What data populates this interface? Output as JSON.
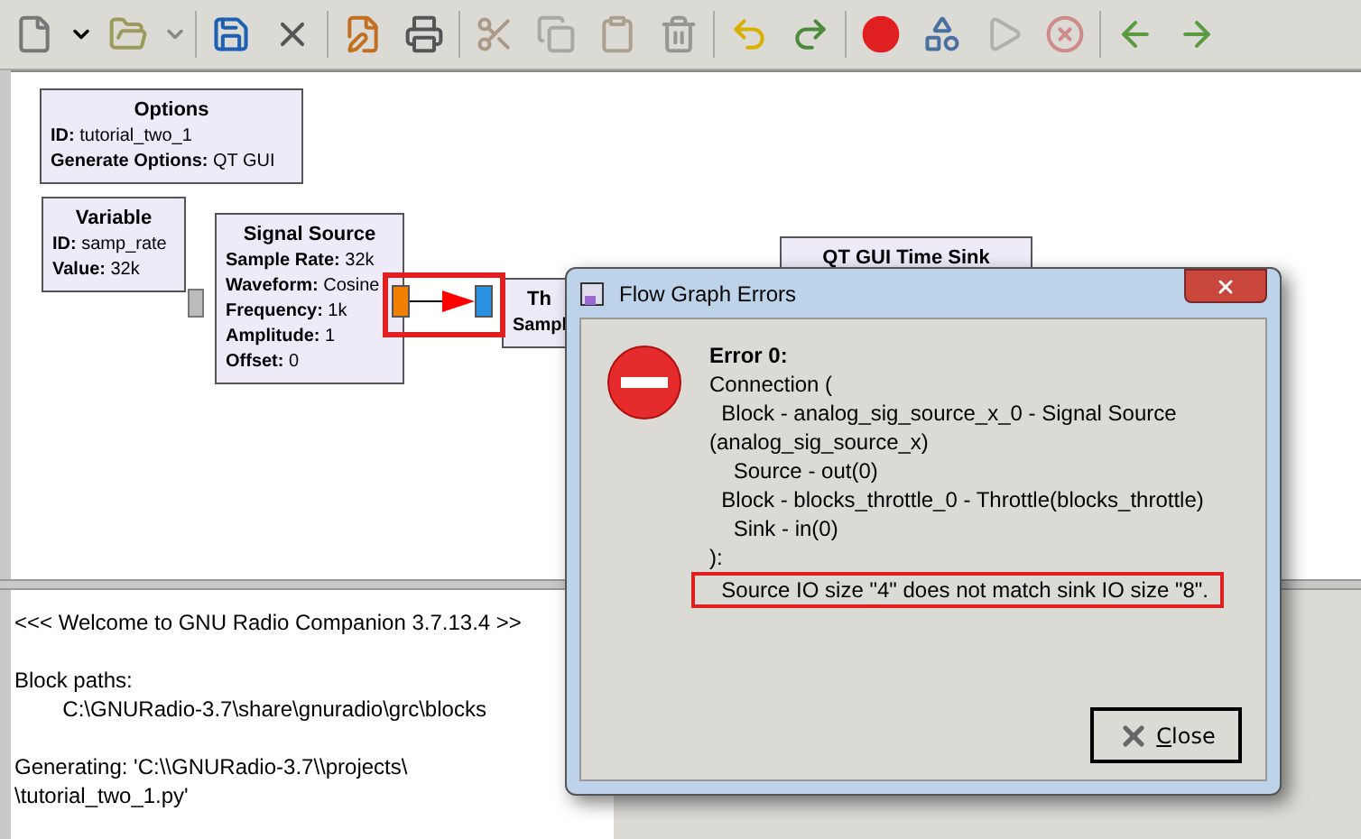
{
  "toolbar": [
    {
      "disabled": false
    },
    {
      "disabled": false
    },
    {
      "disabled": false
    },
    {
      "disabled": false
    },
    {
      "disabled": false
    },
    {
      "disabled": false
    },
    {
      "disabled": false
    },
    {
      "disabled": false
    },
    {
      "disabled": true
    },
    {
      "disabled": true
    },
    {
      "disabled": true
    },
    {
      "disabled": true
    },
    {
      "disabled": false
    },
    {
      "disabled": false
    },
    {
      "disabled": false
    },
    {
      "disabled": false
    },
    {
      "disabled": true
    },
    {
      "disabled": true
    },
    {
      "disabled": false
    },
    {
      "disabled": false
    }
  ],
  "canvas": {
    "blocks": [
      {
        "title": "Options",
        "params": [
          {
            "key": "ID:",
            "value": "tutorial_two_1"
          },
          {
            "key": "Generate Options:",
            "value": "QT GUI"
          }
        ]
      },
      {
        "title": "Variable",
        "params": [
          {
            "key": "ID:",
            "value": "samp_rate"
          },
          {
            "key": "Value:",
            "value": "32k"
          }
        ]
      },
      {
        "title": "Signal Source",
        "params": [
          {
            "key": "Sample Rate:",
            "value": "32k"
          },
          {
            "key": "Waveform:",
            "value": "Cosine"
          },
          {
            "key": "Frequency:",
            "value": "1k"
          },
          {
            "key": "Amplitude:",
            "value": "1"
          },
          {
            "key": "Offset:",
            "value": "0"
          }
        ]
      },
      {
        "title": "Th",
        "params": [
          {
            "key": "Sampl"
          }
        ]
      },
      {
        "title": "QT GUI Time Sink"
      }
    ]
  },
  "console": {
    "paragraphs": [
      [
        "<<< Welcome to GNU Radio Companion 3.7.13.4 >>"
      ],
      [
        "Block paths:",
        "        C:\\GNURadio-3.7\\share\\gnuradio\\grc\\blocks"
      ],
      [
        "Generating: 'C:\\\\GNURadio-3.7\\\\projects\\",
        "\\tutorial_two_1.py'"
      ]
    ]
  },
  "dialog": {
    "title": "Flow Graph Errors",
    "heading": "Error 0:",
    "lines": [
      {
        "text": "Connection (",
        "highlighted": false
      },
      {
        "text": "  Block - analog_sig_source_x_0 - Signal Source",
        "highlighted": false
      },
      {
        "text": "(analog_sig_source_x)",
        "highlighted": false
      },
      {
        "text": "    Source - out(0)",
        "highlighted": false
      },
      {
        "text": "  Block - blocks_throttle_0 - Throttle(blocks_throttle)",
        "highlighted": false
      },
      {
        "text": "    Sink - in(0)",
        "highlighted": false
      },
      {
        "text": "):",
        "highlighted": false
      },
      {
        "text": "  Source IO size \"4\" does not match sink IO size \"8\".",
        "highlighted": true
      }
    ],
    "button": "Close"
  }
}
